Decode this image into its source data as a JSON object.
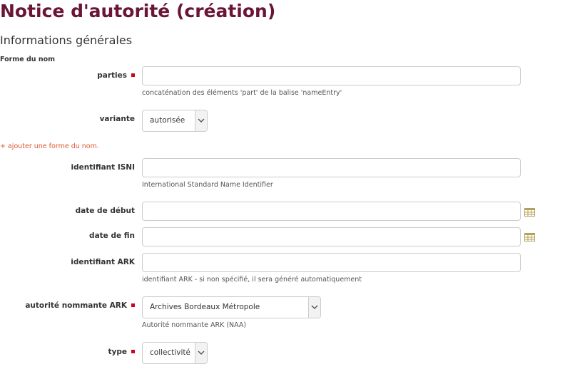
{
  "page": {
    "title": "Notice d'autorité (création)"
  },
  "section": {
    "title": "Informations générales"
  },
  "form": {
    "legend": "Forme du nom",
    "add_name_form": "+ ajouter une forme du nom.",
    "fields": {
      "parties": {
        "label": "parties",
        "value": "",
        "help": "concaténation des éléments 'part' de la balise 'nameEntry'"
      },
      "variante": {
        "label": "variante",
        "value": "autorisée"
      },
      "isni": {
        "label": "identifiant ISNI",
        "value": "",
        "help": "International Standard Name Identifier"
      },
      "date_debut": {
        "label": "date de début",
        "value": ""
      },
      "date_fin": {
        "label": "date de fin",
        "value": ""
      },
      "ark": {
        "label": "identifiant ARK",
        "value": "",
        "help": "identifiant ARK - si non spécifié, il sera généré automatiquement"
      },
      "autorite_ark": {
        "label": "autorité nommante ARK",
        "value": "Archives Bordeaux Métropole",
        "help": "Autorité nommante ARK (NAA)"
      },
      "type": {
        "label": "type",
        "value": "collectivité"
      }
    }
  },
  "colors": {
    "title": "#6a1536",
    "required": "#d0021b",
    "link": "#e0582f",
    "calendar": "#b5a25a"
  },
  "icons": {
    "calendar": "calendar-icon",
    "dropdown": "chevron-down-icon"
  }
}
